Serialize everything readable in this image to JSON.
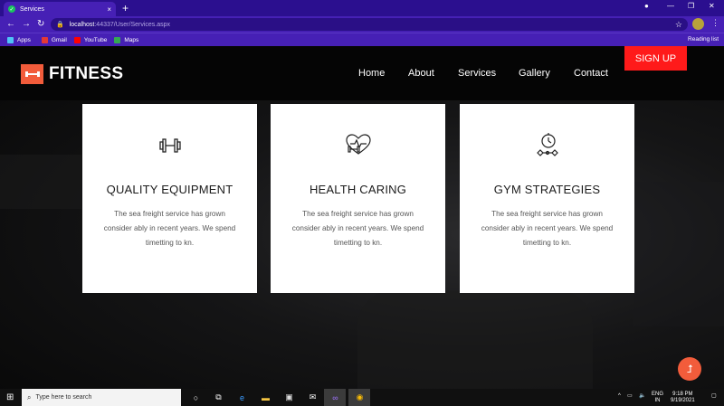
{
  "browser": {
    "tab_title": "Services",
    "tab_close": "×",
    "new_tab": "+",
    "url_host": "localhost",
    "url_rest": ":44337/User/Services.aspx",
    "bookmarks": [
      {
        "label": "Apps",
        "color": "#4fc3f7"
      },
      {
        "label": "Gmail",
        "color": "#e53935"
      },
      {
        "label": "YouTube",
        "color": "#ff0000"
      },
      {
        "label": "Maps",
        "color": "#34a853"
      }
    ],
    "reading_list": "Reading list"
  },
  "site": {
    "brand": "FITNESS",
    "accent_color": "#f25c3b",
    "nav": [
      {
        "label": "Home"
      },
      {
        "label": "About"
      },
      {
        "label": "Services"
      },
      {
        "label": "Gallery"
      },
      {
        "label": "Contact"
      }
    ],
    "signup_label": "SIGN UP",
    "cards": [
      {
        "title": "QUALITY EQUIPMENT",
        "icon": "dumbbell-icon",
        "text": "The sea freight service has grown consider ably in recent years. We spend timetting to kn."
      },
      {
        "title": "HEALTH CARING",
        "icon": "heart-dumbbell-icon",
        "text": "The sea freight service has grown consider ably in recent years. We spend timetting to kn."
      },
      {
        "title": "GYM STRATEGIES",
        "icon": "stopwatch-dumbbell-icon",
        "text": "The sea freight service has grown consider ably in recent years. We spend timetting to kn."
      }
    ],
    "scroll_top_icon": "arrow-up-icon"
  },
  "taskbar": {
    "search_placeholder": "Type here to search",
    "lang_top": "ENG",
    "lang_bottom": "IN",
    "time": "9:18 PM",
    "date": "9/19/2021"
  }
}
